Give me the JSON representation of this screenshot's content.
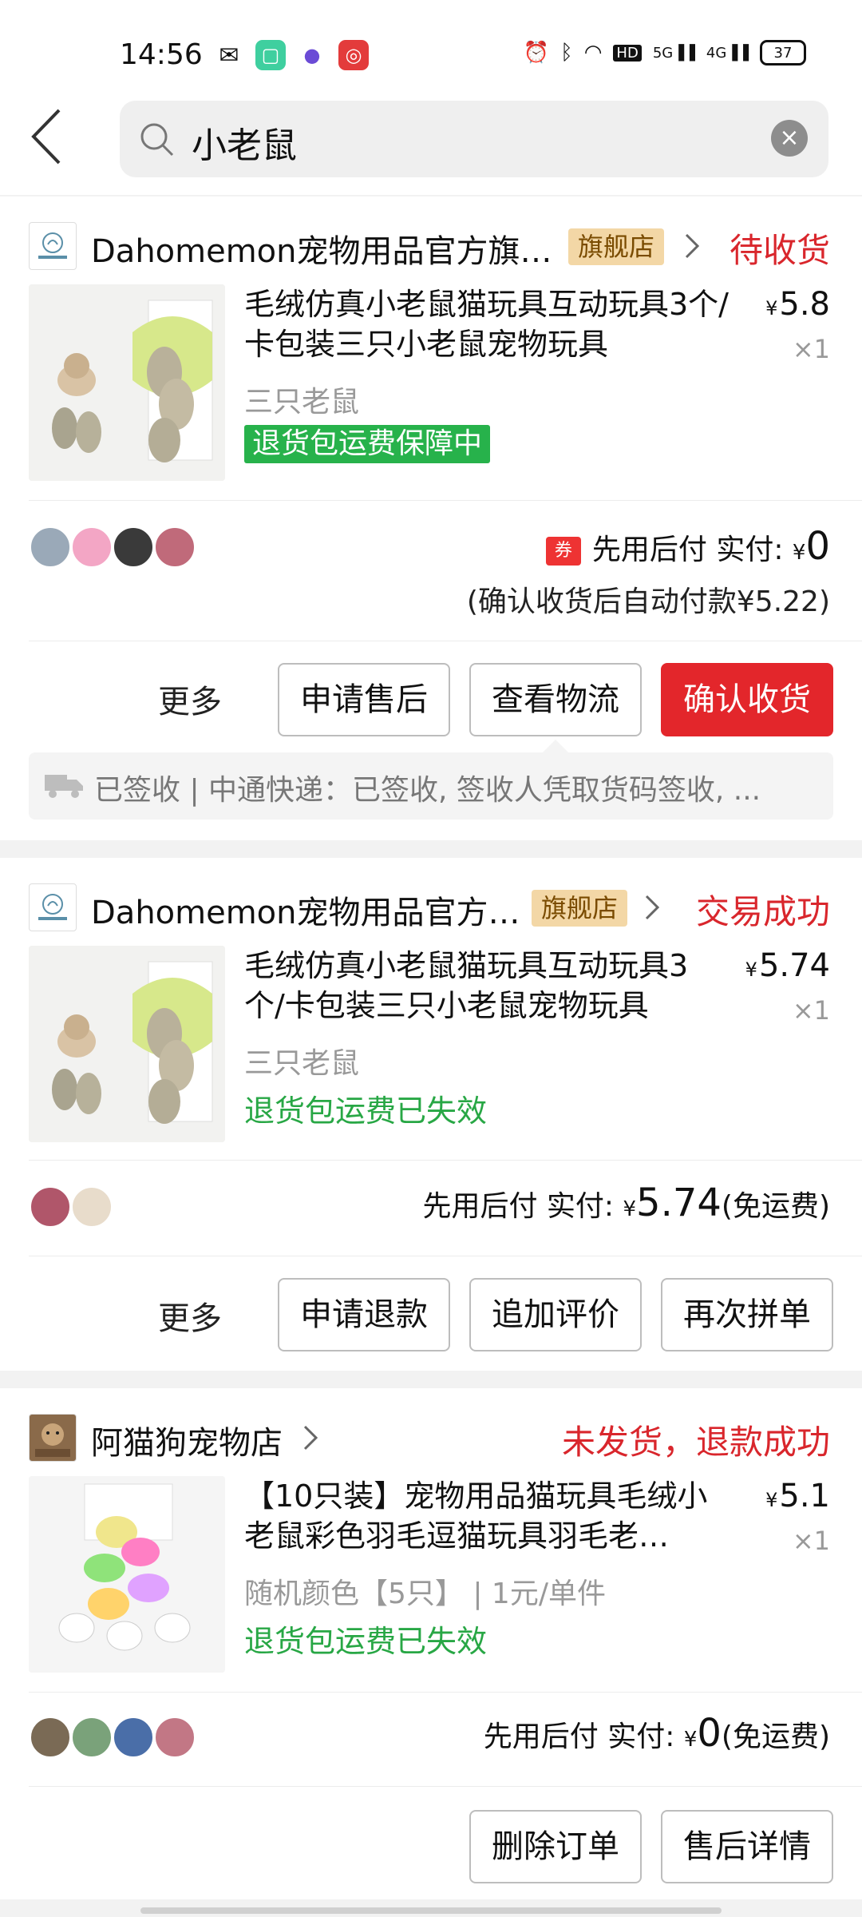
{
  "status_bar": {
    "time": "14:56",
    "network_hd": "HD",
    "net1": "5G",
    "net2": "4G",
    "battery": "37"
  },
  "search": {
    "query": "小老鼠"
  },
  "colors": {
    "accent_red": "#d9262c",
    "green": "#28a745",
    "flagship_bg": "#f3d7a6"
  },
  "orders": [
    {
      "shop": "Dahomemon宠物用品官方旗…",
      "flag": "旗舰店",
      "status": "待收货",
      "title": "毛绒仿真小老鼠猫玩具互动玩具3个/卡包装三只小老鼠宠物玩具",
      "price_symbol": "¥",
      "price": "5.8",
      "qty": "×1",
      "variant": "三只老鼠",
      "badge": "退货包运费保障中",
      "pay_prefix": "券",
      "pay_label": "先用后付 实付:",
      "pay_symbol": "¥",
      "pay_amount": "0",
      "pay_note": "(确认收货后自动付款¥5.22)",
      "more": "更多",
      "buttons": [
        "申请售后",
        "查看物流",
        "确认收货"
      ],
      "logistics": "已签收 | 中通快递：已签收, 签收人凭取货码签收, ..."
    },
    {
      "shop": "Dahomemon宠物用品官方…",
      "flag": "旗舰店",
      "status": "交易成功",
      "title": "毛绒仿真小老鼠猫玩具互动玩具3个/卡包装三只小老鼠宠物玩具",
      "price_symbol": "¥",
      "price": "5.74",
      "qty": "×1",
      "variant": "三只老鼠",
      "badge": "退货包运费已失效",
      "pay_label": "先用后付 实付:",
      "pay_symbol": "¥",
      "pay_amount": "5.74",
      "pay_suffix": "(免运费)",
      "more": "更多",
      "buttons": [
        "申请退款",
        "追加评价",
        "再次拼单"
      ]
    },
    {
      "shop": "阿猫狗宠物店",
      "status": "未发货，退款成功",
      "title": "【10只装】宠物用品猫玩具毛绒小老鼠彩色羽毛逗猫玩具羽毛老…",
      "price_symbol": "¥",
      "price": "5.1",
      "qty": "×1",
      "variant": "随机颜色【5只】 | 1元/单件",
      "badge": "退货包运费已失效",
      "pay_label": "先用后付 实付:",
      "pay_symbol": "¥",
      "pay_amount": "0",
      "pay_suffix": "(免运费)",
      "buttons": [
        "删除订单",
        "售后详情"
      ]
    }
  ]
}
